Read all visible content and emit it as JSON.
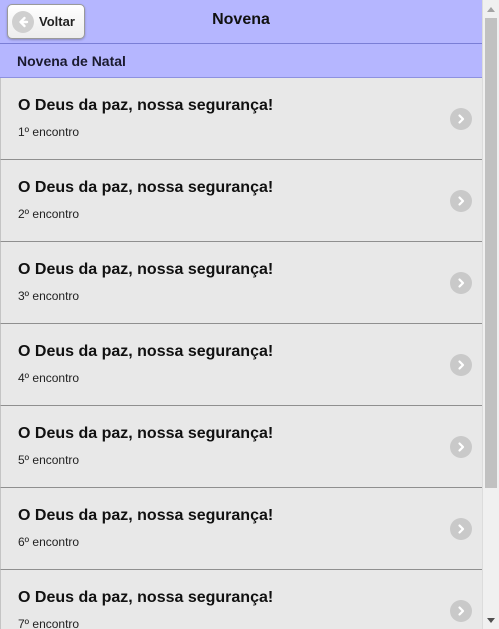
{
  "header": {
    "title": "Novena",
    "back_label": "Voltar",
    "bar_color": "#b5b6ff"
  },
  "section": {
    "label": "Novena de Natal"
  },
  "items": [
    {
      "title": "O Deus da paz, nossa segurança!",
      "subtitle": "1º encontro",
      "icon": "chevron-right-icon"
    },
    {
      "title": "O Deus da paz, nossa segurança!",
      "subtitle": "2º encontro",
      "icon": "chevron-right-icon"
    },
    {
      "title": "O Deus da paz, nossa segurança!",
      "subtitle": "3º encontro",
      "icon": "chevron-right-icon"
    },
    {
      "title": "O Deus da paz, nossa segurança!",
      "subtitle": "4º encontro",
      "icon": "chevron-right-icon"
    },
    {
      "title": "O Deus da paz, nossa segurança!",
      "subtitle": "5º encontro",
      "icon": "chevron-right-icon"
    },
    {
      "title": "O Deus da paz, nossa segurança!",
      "subtitle": "6º encontro",
      "icon": "chevron-right-icon"
    },
    {
      "title": "O Deus da paz, nossa segurança!",
      "subtitle": "7º encontro",
      "icon": "chevron-right-icon"
    }
  ],
  "colors": {
    "list_background": "#e8e8e8",
    "icon_gray": "#c9c9c9"
  }
}
